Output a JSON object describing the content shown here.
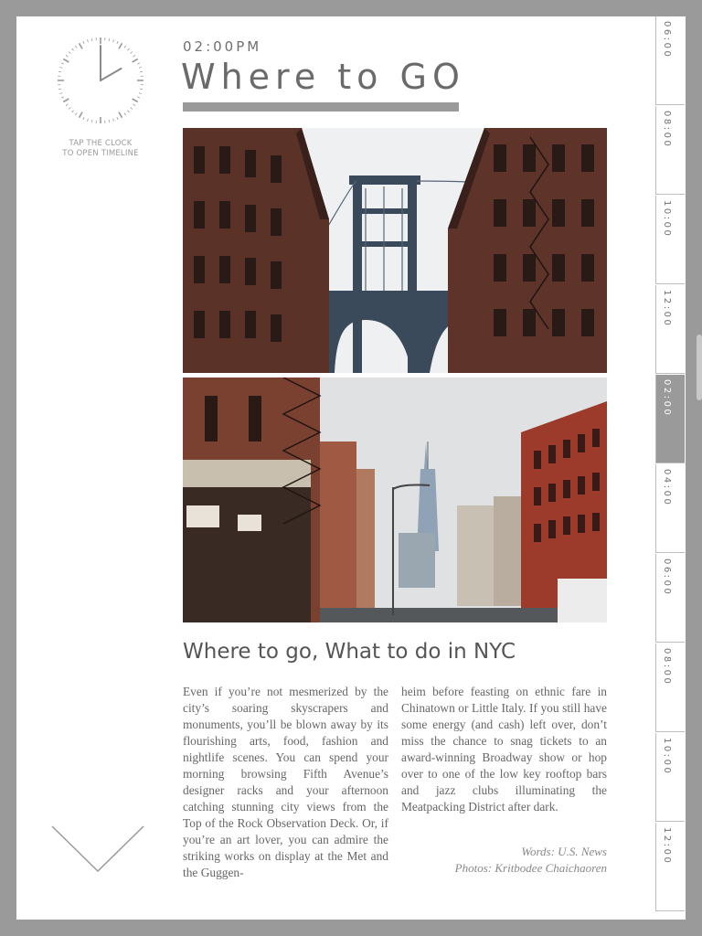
{
  "header": {
    "time": "02:00PM",
    "title": "Where to GO"
  },
  "clock": {
    "hint_line1": "TAP THE CLOCK",
    "hint_line2": "TO OPEN TIMELINE",
    "hour": 2,
    "minute": 0
  },
  "photos": {
    "top": "manhattan-bridge-dumbo-photo",
    "bottom": "world-trade-center-street-photo"
  },
  "article": {
    "title": "Where to go, What to do in NYC",
    "col_left": "Even if you’re not mesmerized by the city’s soaring skyscrapers and monuments, you’ll be blown away by its flourishing arts, food, fashion and nightlife scenes. You can spend your morning browsing Fifth Avenue’s designer racks and your afternoon catching stunning city views from the Top of the Rock Observation Deck. Or, if you’re an art lover, you can admire the striking works on display at the Met and the Guggen-",
    "col_right": "heim before feasting on ethnic fare in Chinatown or Little Italy. If you still have some energy (and cash) left over, don’t miss the chance to snag tickets to an award-winning Broadway show or hop over to one of the low key rooftop bars and jazz clubs illuminating the Meatpacking District after dark.",
    "credit_words": "Words: U.S. News",
    "credit_photos": "Photos: Kritbodee Chaichaoren"
  },
  "timeline": {
    "active_index": 4,
    "slots": [
      "06:00",
      "08:00",
      "10:00",
      "12:00",
      "02:00",
      "04:00",
      "06:00",
      "08:00",
      "10:00",
      "12:00"
    ]
  },
  "colors": {
    "frame": "#9a9a9a",
    "page": "#ffffff",
    "text": "#666666",
    "accent_bar": "#9a9a9a"
  }
}
